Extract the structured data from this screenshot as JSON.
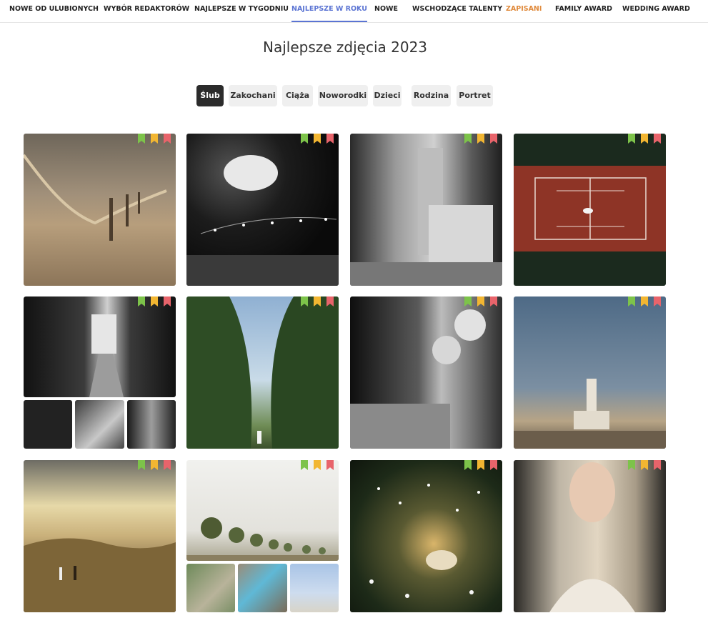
{
  "nav": [
    {
      "label": "NOWE OD ULUBIONYCH"
    },
    {
      "label": "WYBÓR REDAKTORÓW"
    },
    {
      "label": "NAJLEPSZE W TYGODNIU"
    },
    {
      "label": "NAJLEPSZE W ROKU",
      "active": true
    },
    {
      "label": "NOWE"
    },
    {
      "label": "WSCHODZĄCE TALENTY"
    },
    {
      "label": "ZAPISANI"
    },
    {
      "label": "FAMILY AWARD"
    },
    {
      "label": "WEDDING AWARD"
    }
  ],
  "page_title": "Najlepsze zdjęcia 2023",
  "filters": [
    {
      "label": "Ślub",
      "active": true
    },
    {
      "label": "Zakochani"
    },
    {
      "label": "Ciąża"
    },
    {
      "label": "Noworodki"
    },
    {
      "label": "Dzieci"
    },
    {
      "label": "Rodzina"
    },
    {
      "label": "Portret"
    }
  ],
  "colors": {
    "accent": "#5b74d3",
    "saved": "#e08a3c",
    "ribbon_green": "#7dc34a",
    "ribbon_yellow": "#f2b632",
    "ribbon_red": "#e8646b"
  },
  "gallery": [
    {
      "name": "photo-desert-rope"
    },
    {
      "name": "photo-bride-flying-night"
    },
    {
      "name": "photo-bride-getting-ready"
    },
    {
      "name": "photo-tennis-court-aerial"
    },
    {
      "name": "photo-church-aisle-series"
    },
    {
      "name": "photo-cypress-alley"
    },
    {
      "name": "photo-kids-surprised"
    },
    {
      "name": "photo-lighthouse"
    },
    {
      "name": "photo-golden-hills"
    },
    {
      "name": "photo-olive-trees-series"
    },
    {
      "name": "photo-confetti-garden"
    },
    {
      "name": "photo-veil-portrait"
    }
  ]
}
